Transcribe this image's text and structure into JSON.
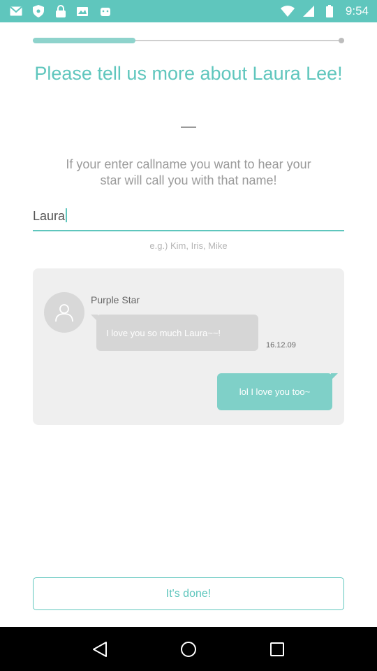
{
  "status_bar": {
    "time": "9:54",
    "background": "#5fc6bd",
    "icons": [
      "gmail-icon",
      "privacy-shield-icon",
      "lock-icon",
      "photo-icon",
      "android-icon",
      "wifi-icon",
      "cellular-signal-icon",
      "battery-icon"
    ]
  },
  "progress": {
    "value": 0.33,
    "accent": "#8ed3cc"
  },
  "title": "Please tell us more about Laura Lee!",
  "subtitle": "If your enter callname you want to hear your star will call you with that name!",
  "name_input": {
    "value": "Laura"
  },
  "hint": "e.g.) Kim, Iris, Mike",
  "preview": {
    "sender": "Purple Star",
    "incoming_message": "I love you so much Laura~~!",
    "date": "16.12.09",
    "outgoing_message": "lol I love you too~"
  },
  "done_button": "It's done!",
  "accent": "#5fc6bd",
  "nav": [
    "back-icon",
    "home-icon",
    "recents-icon"
  ]
}
